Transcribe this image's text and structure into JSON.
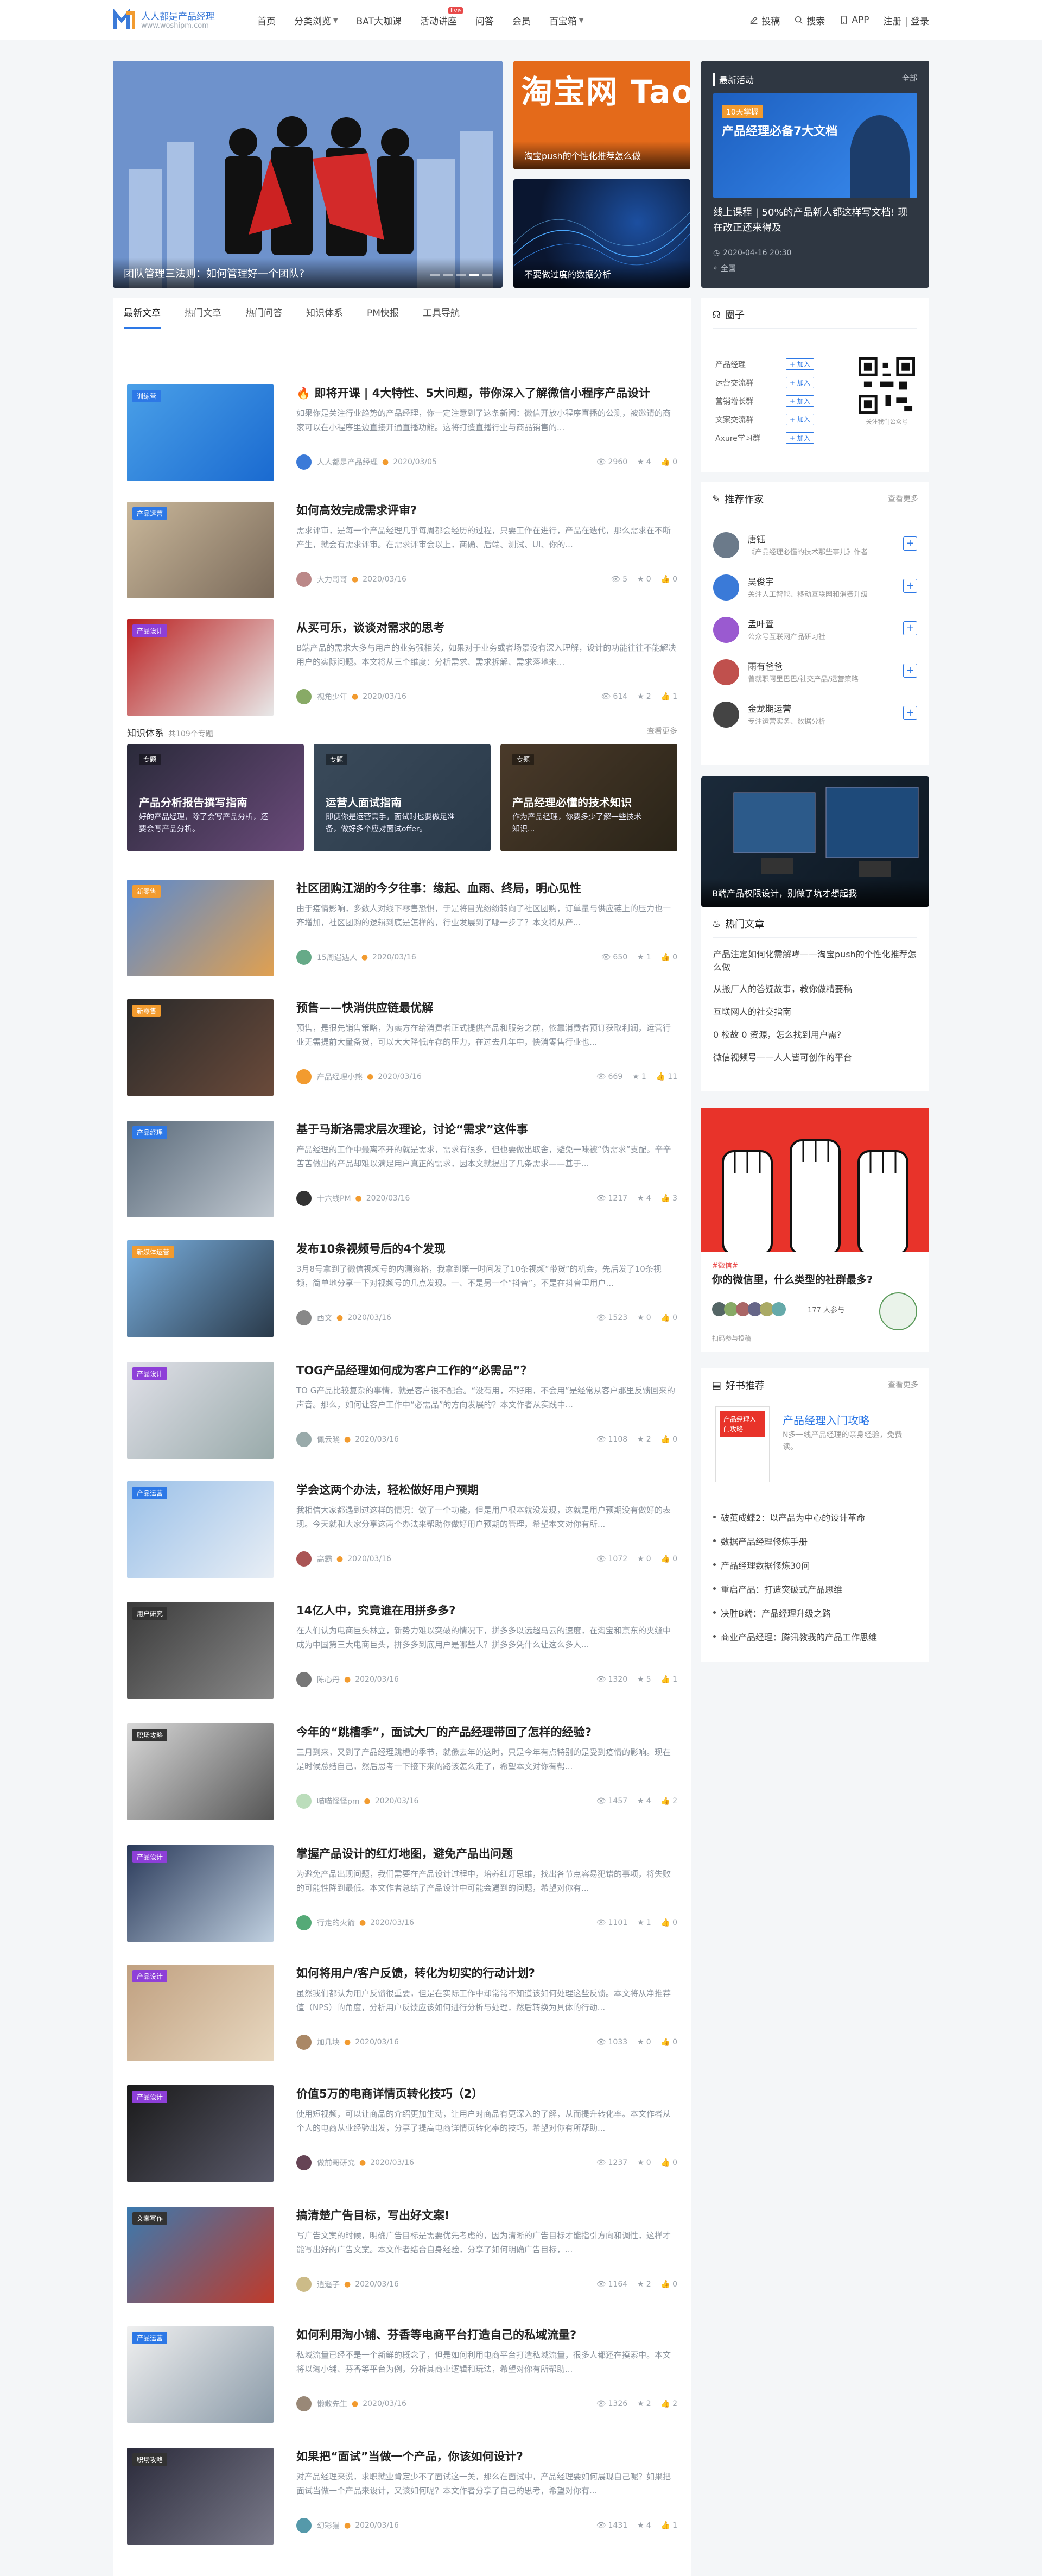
{
  "header": {
    "logo_title": "人人都是产品经理",
    "logo_url": "www.woshipm.com",
    "nav": [
      {
        "label": "首页"
      },
      {
        "label": "分类浏览",
        "caret": true
      },
      {
        "label": "BAT大咖课"
      },
      {
        "label": "活动讲座",
        "badge": "live"
      },
      {
        "label": "问答"
      },
      {
        "label": "会员"
      },
      {
        "label": "百宝箱",
        "caret": true
      }
    ],
    "right": {
      "post": "投稿",
      "search": "搜索",
      "app": "APP",
      "login": "注册 | 登录"
    }
  },
  "hero": {
    "main": {
      "caption": "团队管理三法则：如何管理好一个团队?"
    },
    "side1": {
      "caption": "淘宝push的个性化推荐怎么做"
    },
    "side2": {
      "caption": "不要做过度的数据分析"
    },
    "banner_text": "淘宝网 Taobao.com"
  },
  "activity": {
    "heading": "最新活动",
    "all": "全部",
    "img_title": "产品经理必备7大文档",
    "img_sub": "10天掌握",
    "title": "线上课程 | 50%的产品新人都这样写文档! 现在改正还来得及",
    "date": "2020-04-16 20:30",
    "place": "全国"
  },
  "tabs": [
    "最新文章",
    "热门文章",
    "热门问答",
    "知识体系",
    "PM快报",
    "工具导航"
  ],
  "articles": [
    {
      "title": "即将开课 | 4大特性、5大问题，带你深入了解微信小程序产品设计",
      "desc": "如果你是关注行业趋势的产品经理，你一定注意到了这条新闻：微信开放小程序直播的公测，被邀请的商家可以在小程序里边直接开通直播功能。这将打造直播行业与商品销售的...",
      "author": "人人都是产品经理",
      "date": "2020/03/05",
      "views": "2960",
      "likes": "4",
      "comments": "0",
      "tag": "训练营",
      "hot": true
    },
    {
      "title": "如何高效完成需求评审?",
      "desc": "需求评审，是每一个产品经理几乎每周都会经历的过程，只要工作在进行，产品在迭代，那么需求在不断产生，就会有需求评审。在需求评审会以上，商确、后端、测试、UI、你的...",
      "author": "大力哥哥",
      "date": "2020/03/16",
      "views": "5",
      "likes": "0",
      "comments": "0",
      "tag": "产品运营"
    },
    {
      "title": "从买可乐，谈谈对需求的思考",
      "desc": "B端产品的需求大多与用户的业务强相关，如果对于业务或者场景没有深入理解，设计的功能往往不能解决用户的实际问题。本文将从三个维度：分析需求、需求拆解、需求落地来...",
      "author": "视角少年",
      "date": "2020/03/16",
      "views": "614",
      "likes": "2",
      "comments": "1",
      "tag": "产品设计"
    },
    {
      "title": "社区团购江湖的今夕往事：缘起、血雨、终局，明心见性",
      "desc": "由于疫情影响，多数人对线下零售恐惧，于是将目光纷纷转向了社区团购，订单量与供应链上的压力也一齐增加，社区团购的逻辑到底是怎样的，行业发展到了哪一步了？本文将从产...",
      "author": "15周遇遇人",
      "date": "2020/03/16",
      "views": "650",
      "likes": "1",
      "comments": "0",
      "tag": "新零售"
    },
    {
      "title": "预售——快消供应链最优解",
      "desc": "预售，是很先销售策略，为卖方在给消费者正式提供产品和服务之前，依靠消费者预订获取利润，运营行业无需提前大量备货，可以大大降低库存的压力，在过去几年中，快消零售行业也...",
      "author": "产品经理小熊",
      "date": "2020/03/16",
      "views": "669",
      "likes": "1",
      "comments": "11",
      "tag": "新零售"
    },
    {
      "title": "基于马斯洛需求层次理论，讨论“需求”这件事",
      "desc": "产品经理的工作中最离不开的就是需求，需求有很多，但也要做出取舍，避免一味被“伪需求”支配。辛辛苦苦做出的产品却难以满足用户真正的需求，因本文就提出了几条需求——基于...",
      "author": "十六线PM",
      "date": "2020/03/16",
      "views": "1217",
      "likes": "4",
      "comments": "3",
      "tag": "产品经理"
    },
    {
      "title": "发布10条视频号后的4个发现",
      "desc": "3月8号拿到了微信视频号的内测资格，我拿到第一时间发了10条视频“带货”的机会，先后发了10条视频，简单地分享一下对视频号的几点发现。一、不是另一个“抖音”，不是在抖音里用户...",
      "author": "西文",
      "date": "2020/03/16",
      "views": "1523",
      "likes": "0",
      "comments": "0",
      "tag": "新媒体运营"
    },
    {
      "title": "TOG产品经理如何成为客户工作的“必需品”？",
      "desc": "TO G产品比较复杂的事情，就是客户很不配合。“没有用，不好用，不会用”是经常从客户那里反馈回来的声音。那么，如何让客户工作中“必需品”的方向发展的？本文作者从实践中...",
      "author": "佩云晓",
      "date": "2020/03/16",
      "views": "1108",
      "likes": "2",
      "comments": "0",
      "tag": "产品设计"
    },
    {
      "title": "学会这两个办法，轻松做好用户预期",
      "desc": "我相信大家都遇到过这样的情况：做了一个功能，但是用户根本就没发现，这就是用户预期没有做好的表现。今天就和大家分享这两个办法来帮助你做好用户预期的管理，希望本文对你有所...",
      "author": "高霸",
      "date": "2020/03/16",
      "views": "1072",
      "likes": "0",
      "comments": "0",
      "tag": "产品运营"
    },
    {
      "title": "14亿人中，究竟谁在用拼多多?",
      "desc": "在人们认为电商巨头林立，新势力难以突破的情况下，拼多多以远超马云的速度，在淘宝和京东的夹缝中成为中国第三大电商巨头，拼多多到底用户是哪些人？拼多多凭什么让这么多人...",
      "author": "陈心丹",
      "date": "2020/03/16",
      "views": "1320",
      "likes": "5",
      "comments": "1",
      "tag": "用户研究"
    },
    {
      "title": "今年的“跳槽季”，面试大厂的产品经理带回了怎样的经验?",
      "desc": "三月到来，又到了产品经理跳槽的季节，就像去年的这时，只是今年有点特别的是受到疫情的影响。现在是时候总结自己，然后思考一下接下来的路该怎么走了，希望本文对你有帮...",
      "author": "喵喵怪怪pm",
      "date": "2020/03/16",
      "views": "1457",
      "likes": "4",
      "comments": "2",
      "tag": "职场攻略"
    },
    {
      "title": "掌握产品设计的红灯地图，避免产品出问题",
      "desc": "为避免产品出现问题，我们需要在产品设计过程中，培养红灯思维，找出各节点容易犯错的事项，将失败的可能性降到最低。本文作者总结了产品设计中可能会遇到的问题，希望对你有...",
      "author": "行走的火箭",
      "date": "2020/03/16",
      "views": "1101",
      "likes": "1",
      "comments": "0",
      "tag": "产品设计"
    },
    {
      "title": "如何将用户/客户反馈，转化为切实的行动计划?",
      "desc": "虽然我们都认为用户反馈很重要，但是在实际工作中却常常不知道该如何处理这些反馈。本文将从净推荐值（NPS）的角度，分析用户反馈应该如何进行分析与处理，然后转换为具体的行动...",
      "author": "加几块",
      "date": "2020/03/16",
      "views": "1033",
      "likes": "0",
      "comments": "0",
      "tag": "产品设计"
    },
    {
      "title": "价值5万的电商详情页转化技巧（2）",
      "desc": "使用短视频，可以让商品的介绍更加生动，让用户对商品有更深入的了解，从而提升转化率。本文作者从个人的电商从业经验出发，分享了提高电商详情页转化率的技巧，希望对你有所帮助...",
      "author": "做前哥研究",
      "date": "2020/03/16",
      "views": "1237",
      "likes": "0",
      "comments": "0",
      "tag": "产品设计"
    },
    {
      "title": "搞清楚广告目标，写出好文案!",
      "desc": "写广告文案的时候，明确广告目标是需要优先考虑的，因为清晰的广告目标才能指引方向和调性，这样才能写出好的广告文案。本文作者结合自身经验，分享了如何明确广告目标，...",
      "author": "逍遥子",
      "date": "2020/03/16",
      "views": "1164",
      "likes": "2",
      "comments": "0",
      "tag": "文案写作"
    },
    {
      "title": "如何利用淘小铺、芬香等电商平台打造自己的私域流量?",
      "desc": "私域流量已经不是一个新鲜的概念了，但是如何利用电商平台打造私域流量，很多人都还在摸索中。本文将以淘小铺、芬香等平台为例，分析其商业逻辑和玩法，希望对你有所帮助...",
      "author": "懒散先生",
      "date": "2020/03/16",
      "views": "1326",
      "likes": "2",
      "comments": "2",
      "tag": "产品运营"
    },
    {
      "title": "如果把“面试”当做一个产品，你该如何设计?",
      "desc": "对产品经理来说，求职就业肯定少不了面试这一关，那么在面试中，产品经理要如何展现自己呢？如果把面试当做一个产品来设计，又该如何呢？本文作者分享了自己的思考，希望对你有...",
      "author": "幻彩猫",
      "date": "2020/03/16",
      "views": "1431",
      "likes": "4",
      "comments": "1",
      "tag": "职场攻略"
    }
  ],
  "knowledge": {
    "heading": "知识体系",
    "count": "共109个专题",
    "more": "查看更多",
    "cards": [
      {
        "tag": "专题",
        "title": "产品分析报告撰写指南",
        "desc": "好的产品经理，除了会写产品分析，还要会写产品分析。"
      },
      {
        "tag": "专题",
        "title": "运营人面试指南",
        "desc": "即便你是运营高手，面试时也要做足准备，做好多个应对面试offer。"
      },
      {
        "tag": "专题",
        "title": "产品经理必懂的技术知识",
        "desc": "作为产品经理，你要多少了解一些技术知识..."
      }
    ]
  },
  "circles": {
    "heading": "圈子",
    "items": [
      "产品经理",
      "运营交流群",
      "营销增长群",
      "文案交流群",
      "Axure学习群"
    ],
    "join": "+ 加入",
    "qr_caption": "关注我们公众号"
  },
  "authors": {
    "heading": "推荐作家",
    "more": "查看更多",
    "items": [
      {
        "name": "唐钰",
        "desc": "《产品经理必懂的技术那些事儿》作者"
      },
      {
        "name": "吴俊宇",
        "desc": "关注人工智能、移动互联网和消费升级"
      },
      {
        "name": "孟叶萱",
        "desc": "公众号互联网产品研习社"
      },
      {
        "name": "雨有爸爸",
        "desc": "曾就职阿里巴巴/社交产品/运营策略"
      },
      {
        "name": "金龙期运营",
        "desc": "专注运营实务、数据分析"
      }
    ],
    "plus": "+"
  },
  "promo1": {
    "caption": "B端产品权限设计，别做了坑才想起我"
  },
  "hot": {
    "heading": "热门文章",
    "items": [
      "产品注定如何化需解哮——淘宝push的个性化推荐怎么做",
      "从搬厂人的答疑故事，教你做精要稿",
      "互联网人的社交指南",
      "0 校故 0 资源，怎么找到用户需?",
      "微信视频号——人人皆可创作的平台"
    ]
  },
  "promo2": {
    "tag": "#微信#",
    "title": "你的微信里，什么类型的社群最多?",
    "count": "177 人参与",
    "caption": "扫码参与投稿"
  },
  "books": {
    "heading": "好书推荐",
    "more": "查看更多",
    "featured": {
      "title": "产品经理入门攻略",
      "desc": "N多一线产品经理的亲身经验，免费读。",
      "cover_title": "产品经理入门攻略"
    },
    "items": [
      "破茧成蝶2：以产品为中心的设计革命",
      "数据产品经理修炼手册",
      "产品经理数据修炼30问",
      "重启产品：打造突破式产品思维",
      "决胜B端：产品经理升级之路",
      "商业产品经理：腾讯教我的产品工作思维"
    ]
  },
  "colors": {
    "accent": "#2d78e6",
    "hot": "#e84a4a",
    "purple": "#8e3fd8",
    "orange": "#f29b2f",
    "blue": "#3b7ad8",
    "dark": "#333"
  }
}
